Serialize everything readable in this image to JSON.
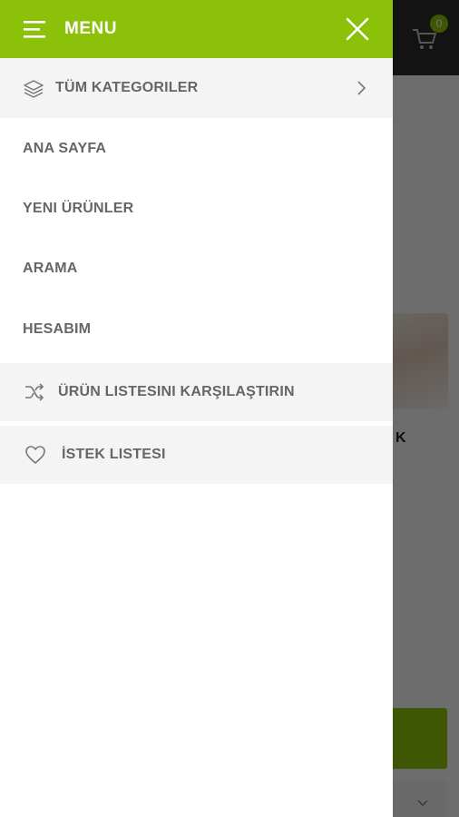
{
  "background_page": {
    "cart_count": "0",
    "product_title_fragment": "K"
  },
  "drawer": {
    "title": "MENU",
    "items": [
      {
        "label": "TÜM KATEGORILER",
        "icon": "layers-icon",
        "has_arrow": true
      },
      {
        "label": "ANA SAYFA"
      },
      {
        "label": "YENI ÜRÜNLER"
      },
      {
        "label": "ARAMA"
      },
      {
        "label": "HESABIM"
      },
      {
        "label": "ÜRÜN LISTESINI KARŞILAŞTIRIN",
        "icon": "shuffle-icon"
      },
      {
        "label": "İSTEK LISTESI",
        "icon": "heart-icon"
      }
    ]
  },
  "colors": {
    "accent": "#8cc10a",
    "header_dark": "#2b2b2b",
    "text": "#666666",
    "shaded_row": "#f4f4f4"
  }
}
